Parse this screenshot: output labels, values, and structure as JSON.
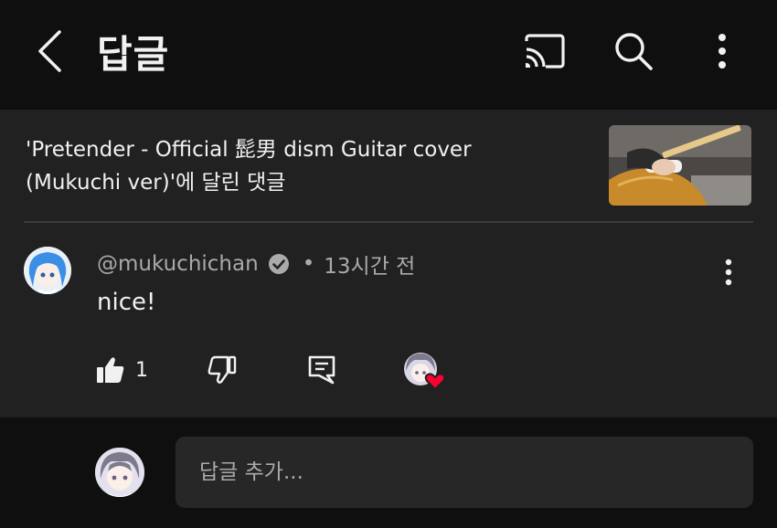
{
  "header": {
    "title": "답글",
    "icons": [
      "back-arrow-icon",
      "cast-icon",
      "search-icon",
      "more-vert-icon"
    ]
  },
  "video": {
    "title_line1": "'Pretender - Official 髭男 dism Guitar cover",
    "title_line2": "(Mukuchi ver)'에 달린 댓글"
  },
  "comment": {
    "author": "@mukuchichan",
    "separator": "•",
    "time": "13시간 전",
    "text": "nice!",
    "like_count": "1",
    "verified": true
  },
  "reply_box": {
    "placeholder": "답글 추가..."
  },
  "colors": {
    "background": "#0f0f0f",
    "panel": "#212121",
    "input": "#272727",
    "text_primary": "#f1f1f1",
    "text_secondary": "#aaaaaa",
    "heart": "#ff0033"
  }
}
